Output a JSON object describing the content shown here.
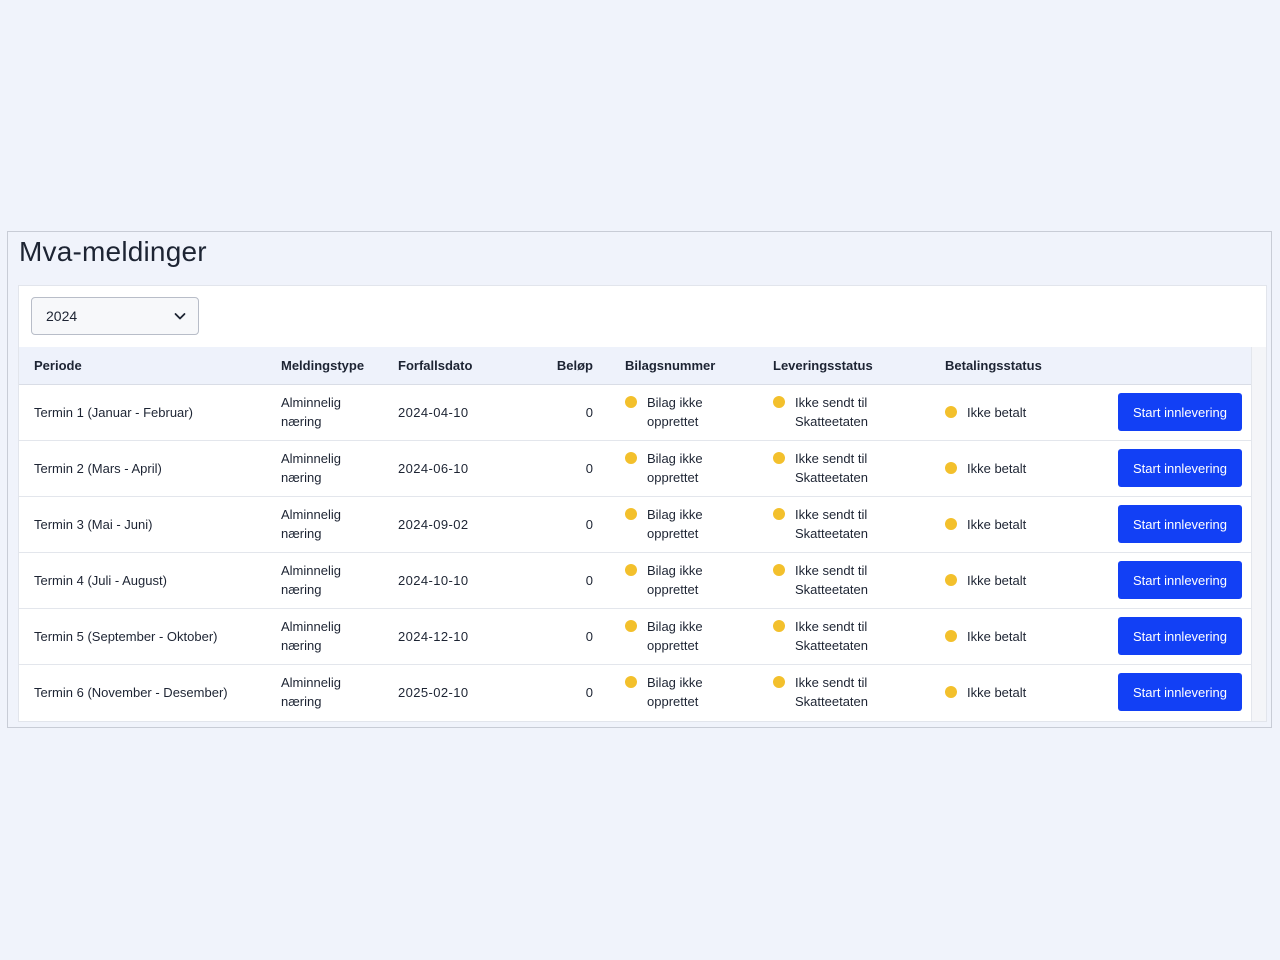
{
  "page": {
    "title": "Mva-meldinger"
  },
  "filter": {
    "year": "2024"
  },
  "table": {
    "headers": {
      "periode": "Periode",
      "meldingstype": "Meldingstype",
      "forfallsdato": "Forfallsdato",
      "belop": "Beløp",
      "bilagsnummer": "Bilagsnummer",
      "leveringsstatus": "Leveringsstatus",
      "betalingsstatus": "Betalingsstatus"
    },
    "rows": [
      {
        "periode": "Termin 1 (Januar - Februar)",
        "meldingstype_line1": "Alminnelig",
        "meldingstype_line2": "næring",
        "forfallsdato": "2024-04-10",
        "belop": "0",
        "bilag_line1": "Bilag ikke",
        "bilag_line2": "opprettet",
        "levering_line1": "Ikke sendt til",
        "levering_line2": "Skatteetaten",
        "betaling": "Ikke betalt",
        "action": "Start innlevering"
      },
      {
        "periode": "Termin 2 (Mars - April)",
        "meldingstype_line1": "Alminnelig",
        "meldingstype_line2": "næring",
        "forfallsdato": "2024-06-10",
        "belop": "0",
        "bilag_line1": "Bilag ikke",
        "bilag_line2": "opprettet",
        "levering_line1": "Ikke sendt til",
        "levering_line2": "Skatteetaten",
        "betaling": "Ikke betalt",
        "action": "Start innlevering"
      },
      {
        "periode": "Termin 3 (Mai - Juni)",
        "meldingstype_line1": "Alminnelig",
        "meldingstype_line2": "næring",
        "forfallsdato": "2024-09-02",
        "belop": "0",
        "bilag_line1": "Bilag ikke",
        "bilag_line2": "opprettet",
        "levering_line1": "Ikke sendt til",
        "levering_line2": "Skatteetaten",
        "betaling": "Ikke betalt",
        "action": "Start innlevering"
      },
      {
        "periode": "Termin 4 (Juli - August)",
        "meldingstype_line1": "Alminnelig",
        "meldingstype_line2": "næring",
        "forfallsdato": "2024-10-10",
        "belop": "0",
        "bilag_line1": "Bilag ikke",
        "bilag_line2": "opprettet",
        "levering_line1": "Ikke sendt til",
        "levering_line2": "Skatteetaten",
        "betaling": "Ikke betalt",
        "action": "Start innlevering"
      },
      {
        "periode": "Termin 5 (September - Oktober)",
        "meldingstype_line1": "Alminnelig",
        "meldingstype_line2": "næring",
        "forfallsdato": "2024-12-10",
        "belop": "0",
        "bilag_line1": "Bilag ikke",
        "bilag_line2": "opprettet",
        "levering_line1": "Ikke sendt til",
        "levering_line2": "Skatteetaten",
        "betaling": "Ikke betalt",
        "action": "Start innlevering"
      },
      {
        "periode": "Termin 6 (November - Desember)",
        "meldingstype_line1": "Alminnelig",
        "meldingstype_line2": "næring",
        "forfallsdato": "2025-02-10",
        "belop": "0",
        "bilag_line1": "Bilag ikke",
        "bilag_line2": "opprettet",
        "levering_line1": "Ikke sendt til",
        "levering_line2": "Skatteetaten",
        "betaling": "Ikke betalt",
        "action": "Start innlevering"
      }
    ]
  },
  "colors": {
    "page_background": "#f0f3fb",
    "header_background": "#eef2fb",
    "status_dot": "#f3c02c",
    "primary_button": "#1240f5"
  },
  "icons": {
    "select_chevron": "chevron-down-icon",
    "status_indicator": "status-dot-icon"
  }
}
